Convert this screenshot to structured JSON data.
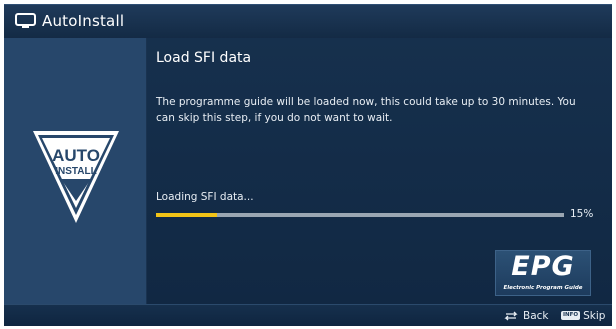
{
  "window": {
    "title": "AutoInstall",
    "icon": "tv-icon"
  },
  "sidebar": {
    "logo_line1": "AUTO",
    "logo_line2": "INSTALL",
    "logo_icon": "auto-install-icon"
  },
  "main": {
    "heading": "Load SFI data",
    "description": "The programme guide will be loaded now, this could take up to 30 minutes. You can skip this step, if you do not want to wait.",
    "loading_label": "Loading SFI data...",
    "progress": {
      "value": 0.15,
      "text": "15%"
    },
    "epg_logo": {
      "title": "EPG",
      "subtitle": "Electronic Program Guide"
    }
  },
  "footer": {
    "back_label": "Back",
    "back_icon": "back-arrows-icon",
    "skip_key": "INFO",
    "skip_label": "Skip"
  },
  "colors": {
    "title_bar": "#1f3a5a",
    "sidebar": "#27476b",
    "main_bg": "#16304d",
    "progress_fill": "#f2c417",
    "progress_track": "#9aa6b2"
  }
}
